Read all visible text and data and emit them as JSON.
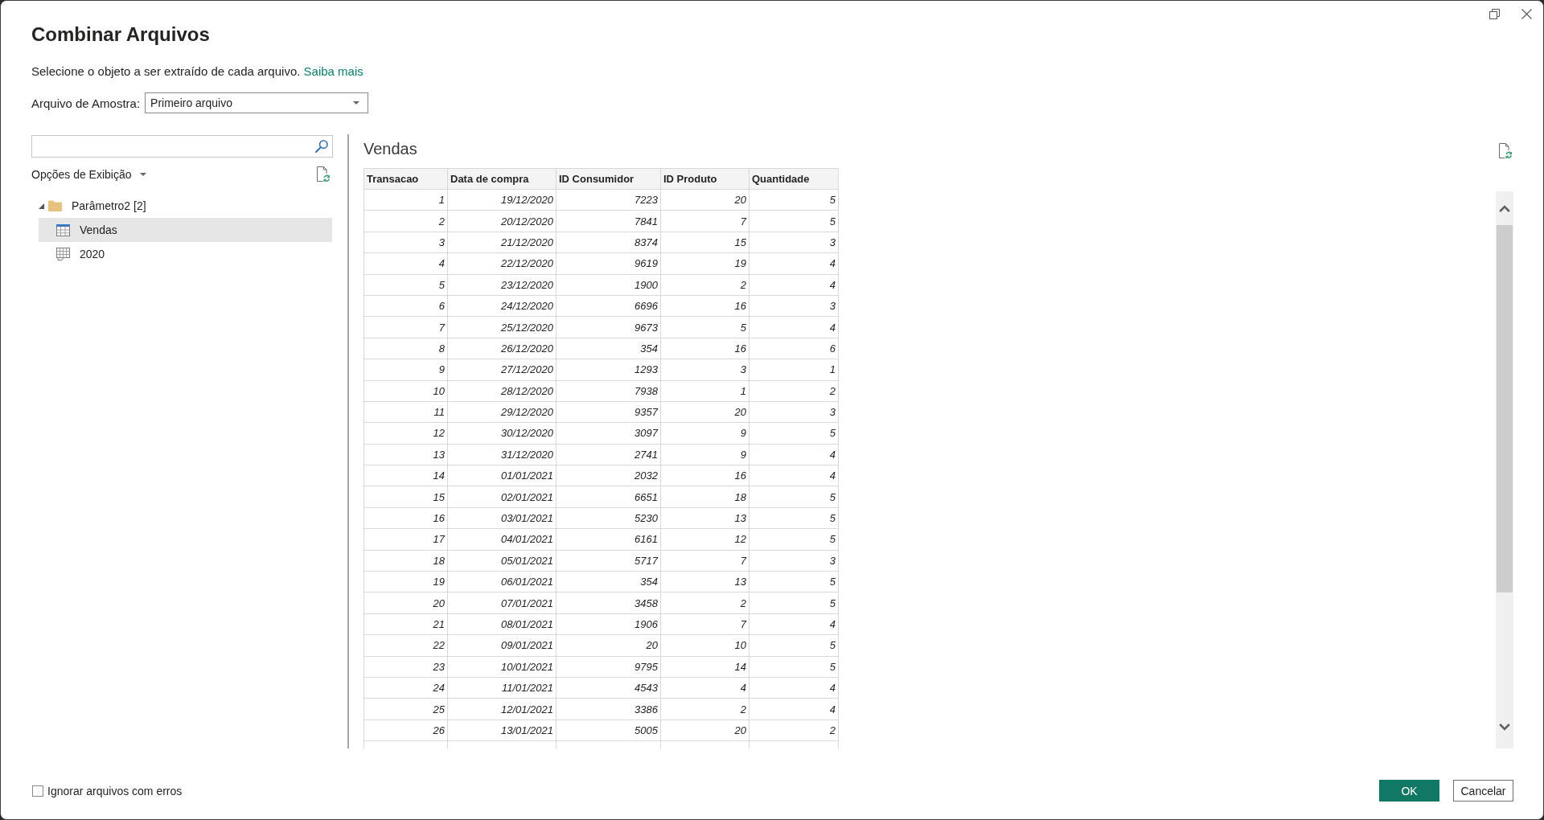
{
  "window": {
    "title": "Combinar Arquivos"
  },
  "description": {
    "text": "Selecione o objeto a ser extraído de cada arquivo.",
    "link": "Saiba mais"
  },
  "sample_file": {
    "label": "Arquivo de Amostra:",
    "value": "Primeiro arquivo"
  },
  "navigator": {
    "display_options": "Opções de Exibição",
    "tree": [
      {
        "label": "Parâmetro2 [2]",
        "kind": "folder",
        "expanded": true,
        "selected": false,
        "children": [
          {
            "label": "Vendas",
            "kind": "table",
            "selected": true
          },
          {
            "label": "2020",
            "kind": "sheet",
            "selected": false
          }
        ]
      }
    ]
  },
  "preview": {
    "title": "Vendas",
    "table": {
      "columns": [
        "Transacao",
        "Data de compra",
        "ID Consumidor",
        "ID Produto",
        "Quantidade"
      ],
      "rows": [
        [
          "1",
          "19/12/2020",
          "7223",
          "20",
          "5"
        ],
        [
          "2",
          "20/12/2020",
          "7841",
          "7",
          "5"
        ],
        [
          "3",
          "21/12/2020",
          "8374",
          "15",
          "3"
        ],
        [
          "4",
          "22/12/2020",
          "9619",
          "19",
          "4"
        ],
        [
          "5",
          "23/12/2020",
          "1900",
          "2",
          "4"
        ],
        [
          "6",
          "24/12/2020",
          "6696",
          "16",
          "3"
        ],
        [
          "7",
          "25/12/2020",
          "9673",
          "5",
          "4"
        ],
        [
          "8",
          "26/12/2020",
          "354",
          "16",
          "6"
        ],
        [
          "9",
          "27/12/2020",
          "1293",
          "3",
          "1"
        ],
        [
          "10",
          "28/12/2020",
          "7938",
          "1",
          "2"
        ],
        [
          "11",
          "29/12/2020",
          "9357",
          "20",
          "3"
        ],
        [
          "12",
          "30/12/2020",
          "3097",
          "9",
          "5"
        ],
        [
          "13",
          "31/12/2020",
          "2741",
          "9",
          "4"
        ],
        [
          "14",
          "01/01/2021",
          "2032",
          "16",
          "4"
        ],
        [
          "15",
          "02/01/2021",
          "6651",
          "18",
          "5"
        ],
        [
          "16",
          "03/01/2021",
          "5230",
          "13",
          "5"
        ],
        [
          "17",
          "04/01/2021",
          "6161",
          "12",
          "5"
        ],
        [
          "18",
          "05/01/2021",
          "5717",
          "7",
          "3"
        ],
        [
          "19",
          "06/01/2021",
          "354",
          "13",
          "5"
        ],
        [
          "20",
          "07/01/2021",
          "3458",
          "2",
          "5"
        ],
        [
          "21",
          "08/01/2021",
          "1906",
          "7",
          "4"
        ],
        [
          "22",
          "09/01/2021",
          "20",
          "10",
          "5"
        ],
        [
          "23",
          "10/01/2021",
          "9795",
          "14",
          "5"
        ],
        [
          "24",
          "11/01/2021",
          "4543",
          "4",
          "4"
        ],
        [
          "25",
          "12/01/2021",
          "3386",
          "2",
          "4"
        ],
        [
          "26",
          "13/01/2021",
          "5005",
          "20",
          "2"
        ]
      ]
    }
  },
  "ignore_errors": {
    "label": "Ignorar arquivos com erros",
    "checked": false
  },
  "buttons": [
    {
      "label": "OK",
      "kind": "primary"
    },
    {
      "label": "Cancelar",
      "kind": "secondary"
    }
  ]
}
